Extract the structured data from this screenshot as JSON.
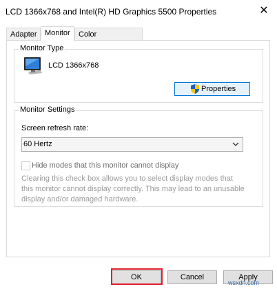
{
  "window": {
    "title": "LCD 1366x768 and Intel(R) HD Graphics 5500 Properties",
    "close_glyph": "✕"
  },
  "tabs": [
    {
      "label": "Adapter",
      "active": false
    },
    {
      "label": "Monitor",
      "active": true
    },
    {
      "label": "Color Management",
      "active": false
    }
  ],
  "monitor_type": {
    "group_label": "Monitor Type",
    "device_name": "LCD 1366x768",
    "properties_label": "Properties"
  },
  "monitor_settings": {
    "group_label": "Monitor Settings",
    "refresh_label": "Screen refresh rate:",
    "refresh_value": "60 Hertz",
    "hide_modes_label": "Hide modes that this monitor cannot display",
    "hide_modes_checked": false,
    "description": "Clearing this check box allows you to select display modes that this monitor cannot display correctly. This may lead to an unusable display and/or damaged hardware."
  },
  "footer": {
    "ok_label": "OK",
    "cancel_label": "Cancel",
    "apply_label": "Apply",
    "watermark": "wsxdn.com"
  },
  "colors": {
    "accent": "#0078d7",
    "highlight": "#e0202a"
  },
  "icons": [
    "close-icon",
    "monitor-icon",
    "shield-icon",
    "chevron-down-icon"
  ]
}
